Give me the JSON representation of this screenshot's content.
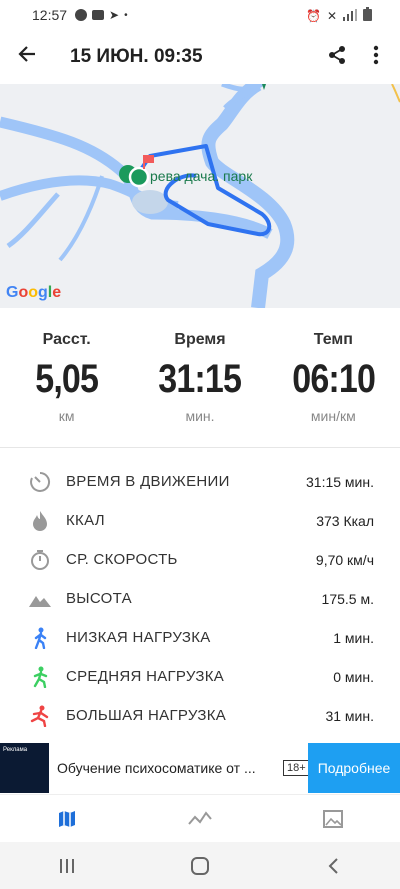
{
  "status_bar": {
    "time": "12:57"
  },
  "app_bar": {
    "title": "15 ИЮН. 09:35"
  },
  "map": {
    "place_label": "рева дача. парк",
    "attribution": "Google"
  },
  "summary": [
    {
      "label": "Расст.",
      "value": "5,05",
      "unit": "км"
    },
    {
      "label": "Время",
      "value": "31:15",
      "unit": "мин."
    },
    {
      "label": "Темп",
      "value": "06:10",
      "unit": "мин/км"
    }
  ],
  "details": [
    {
      "label": "ВРЕМЯ В ДВИЖЕНИИ",
      "value": "31:15 мин.",
      "icon": "timer-icon"
    },
    {
      "label": "ККАЛ",
      "value": "373 Ккал",
      "icon": "flame-icon"
    },
    {
      "label": "СР. СКОРОСТЬ",
      "value": "9,70 км/ч",
      "icon": "stopwatch-icon"
    },
    {
      "label": "ВЫСОТА",
      "value": "175.5 м.",
      "icon": "mountain-icon"
    },
    {
      "label": "НИЗКАЯ НАГРУЗКА",
      "value": "1 мин.",
      "icon": "walker-blue-icon"
    },
    {
      "label": "СРЕДНЯЯ НАГРУЗКА",
      "value": "0 мин.",
      "icon": "walker-green-icon"
    },
    {
      "label": "БОЛЬШАЯ НАГРУЗКА",
      "value": "31 мин.",
      "icon": "runner-red-icon"
    }
  ],
  "ad": {
    "tag": "Реклама",
    "text": "Обучение психосоматике от ...",
    "age": "18+",
    "cta": "Подробнее"
  },
  "colors": {
    "route": "#2f73f0",
    "water": "#9fc5f8",
    "accent": "#1e9ff2",
    "tab_active": "#1e6fd9"
  }
}
